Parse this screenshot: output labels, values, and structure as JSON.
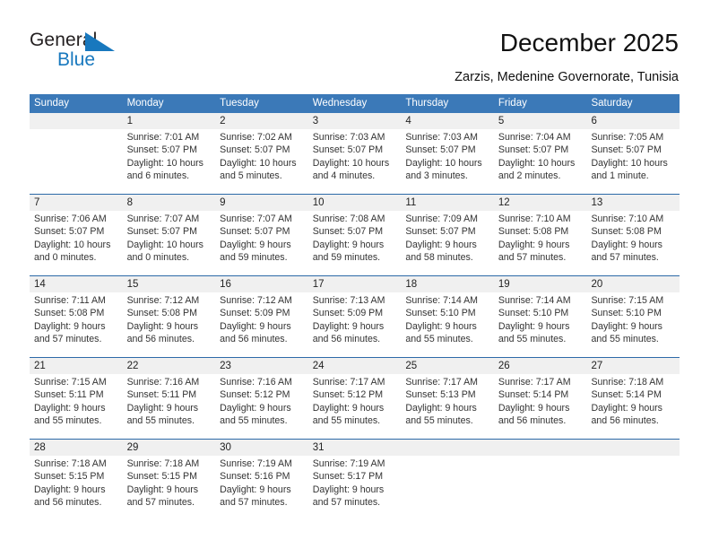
{
  "brand": {
    "name_top": "General",
    "name_bottom": "Blue",
    "mark": "triangle-logo-mark",
    "accent_color": "#1878be"
  },
  "header": {
    "title": "December 2025",
    "subtitle": "Zarzis, Medenine Governorate, Tunisia"
  },
  "calendar": {
    "header_bg": "#3b79b8",
    "daynum_bg": "#f0f0f0",
    "weekdays": [
      "Sunday",
      "Monday",
      "Tuesday",
      "Wednesday",
      "Thursday",
      "Friday",
      "Saturday"
    ],
    "weeks": [
      [
        {
          "day": ""
        },
        {
          "day": "1",
          "sunrise": "Sunrise: 7:01 AM",
          "sunset": "Sunset: 5:07 PM",
          "daylight1": "Daylight: 10 hours",
          "daylight2": "and 6 minutes."
        },
        {
          "day": "2",
          "sunrise": "Sunrise: 7:02 AM",
          "sunset": "Sunset: 5:07 PM",
          "daylight1": "Daylight: 10 hours",
          "daylight2": "and 5 minutes."
        },
        {
          "day": "3",
          "sunrise": "Sunrise: 7:03 AM",
          "sunset": "Sunset: 5:07 PM",
          "daylight1": "Daylight: 10 hours",
          "daylight2": "and 4 minutes."
        },
        {
          "day": "4",
          "sunrise": "Sunrise: 7:03 AM",
          "sunset": "Sunset: 5:07 PM",
          "daylight1": "Daylight: 10 hours",
          "daylight2": "and 3 minutes."
        },
        {
          "day": "5",
          "sunrise": "Sunrise: 7:04 AM",
          "sunset": "Sunset: 5:07 PM",
          "daylight1": "Daylight: 10 hours",
          "daylight2": "and 2 minutes."
        },
        {
          "day": "6",
          "sunrise": "Sunrise: 7:05 AM",
          "sunset": "Sunset: 5:07 PM",
          "daylight1": "Daylight: 10 hours",
          "daylight2": "and 1 minute."
        }
      ],
      [
        {
          "day": "7",
          "sunrise": "Sunrise: 7:06 AM",
          "sunset": "Sunset: 5:07 PM",
          "daylight1": "Daylight: 10 hours",
          "daylight2": "and 0 minutes."
        },
        {
          "day": "8",
          "sunrise": "Sunrise: 7:07 AM",
          "sunset": "Sunset: 5:07 PM",
          "daylight1": "Daylight: 10 hours",
          "daylight2": "and 0 minutes."
        },
        {
          "day": "9",
          "sunrise": "Sunrise: 7:07 AM",
          "sunset": "Sunset: 5:07 PM",
          "daylight1": "Daylight: 9 hours",
          "daylight2": "and 59 minutes."
        },
        {
          "day": "10",
          "sunrise": "Sunrise: 7:08 AM",
          "sunset": "Sunset: 5:07 PM",
          "daylight1": "Daylight: 9 hours",
          "daylight2": "and 59 minutes."
        },
        {
          "day": "11",
          "sunrise": "Sunrise: 7:09 AM",
          "sunset": "Sunset: 5:07 PM",
          "daylight1": "Daylight: 9 hours",
          "daylight2": "and 58 minutes."
        },
        {
          "day": "12",
          "sunrise": "Sunrise: 7:10 AM",
          "sunset": "Sunset: 5:08 PM",
          "daylight1": "Daylight: 9 hours",
          "daylight2": "and 57 minutes."
        },
        {
          "day": "13",
          "sunrise": "Sunrise: 7:10 AM",
          "sunset": "Sunset: 5:08 PM",
          "daylight1": "Daylight: 9 hours",
          "daylight2": "and 57 minutes."
        }
      ],
      [
        {
          "day": "14",
          "sunrise": "Sunrise: 7:11 AM",
          "sunset": "Sunset: 5:08 PM",
          "daylight1": "Daylight: 9 hours",
          "daylight2": "and 57 minutes."
        },
        {
          "day": "15",
          "sunrise": "Sunrise: 7:12 AM",
          "sunset": "Sunset: 5:08 PM",
          "daylight1": "Daylight: 9 hours",
          "daylight2": "and 56 minutes."
        },
        {
          "day": "16",
          "sunrise": "Sunrise: 7:12 AM",
          "sunset": "Sunset: 5:09 PM",
          "daylight1": "Daylight: 9 hours",
          "daylight2": "and 56 minutes."
        },
        {
          "day": "17",
          "sunrise": "Sunrise: 7:13 AM",
          "sunset": "Sunset: 5:09 PM",
          "daylight1": "Daylight: 9 hours",
          "daylight2": "and 56 minutes."
        },
        {
          "day": "18",
          "sunrise": "Sunrise: 7:14 AM",
          "sunset": "Sunset: 5:10 PM",
          "daylight1": "Daylight: 9 hours",
          "daylight2": "and 55 minutes."
        },
        {
          "day": "19",
          "sunrise": "Sunrise: 7:14 AM",
          "sunset": "Sunset: 5:10 PM",
          "daylight1": "Daylight: 9 hours",
          "daylight2": "and 55 minutes."
        },
        {
          "day": "20",
          "sunrise": "Sunrise: 7:15 AM",
          "sunset": "Sunset: 5:10 PM",
          "daylight1": "Daylight: 9 hours",
          "daylight2": "and 55 minutes."
        }
      ],
      [
        {
          "day": "21",
          "sunrise": "Sunrise: 7:15 AM",
          "sunset": "Sunset: 5:11 PM",
          "daylight1": "Daylight: 9 hours",
          "daylight2": "and 55 minutes."
        },
        {
          "day": "22",
          "sunrise": "Sunrise: 7:16 AM",
          "sunset": "Sunset: 5:11 PM",
          "daylight1": "Daylight: 9 hours",
          "daylight2": "and 55 minutes."
        },
        {
          "day": "23",
          "sunrise": "Sunrise: 7:16 AM",
          "sunset": "Sunset: 5:12 PM",
          "daylight1": "Daylight: 9 hours",
          "daylight2": "and 55 minutes."
        },
        {
          "day": "24",
          "sunrise": "Sunrise: 7:17 AM",
          "sunset": "Sunset: 5:12 PM",
          "daylight1": "Daylight: 9 hours",
          "daylight2": "and 55 minutes."
        },
        {
          "day": "25",
          "sunrise": "Sunrise: 7:17 AM",
          "sunset": "Sunset: 5:13 PM",
          "daylight1": "Daylight: 9 hours",
          "daylight2": "and 55 minutes."
        },
        {
          "day": "26",
          "sunrise": "Sunrise: 7:17 AM",
          "sunset": "Sunset: 5:14 PM",
          "daylight1": "Daylight: 9 hours",
          "daylight2": "and 56 minutes."
        },
        {
          "day": "27",
          "sunrise": "Sunrise: 7:18 AM",
          "sunset": "Sunset: 5:14 PM",
          "daylight1": "Daylight: 9 hours",
          "daylight2": "and 56 minutes."
        }
      ],
      [
        {
          "day": "28",
          "sunrise": "Sunrise: 7:18 AM",
          "sunset": "Sunset: 5:15 PM",
          "daylight1": "Daylight: 9 hours",
          "daylight2": "and 56 minutes."
        },
        {
          "day": "29",
          "sunrise": "Sunrise: 7:18 AM",
          "sunset": "Sunset: 5:15 PM",
          "daylight1": "Daylight: 9 hours",
          "daylight2": "and 57 minutes."
        },
        {
          "day": "30",
          "sunrise": "Sunrise: 7:19 AM",
          "sunset": "Sunset: 5:16 PM",
          "daylight1": "Daylight: 9 hours",
          "daylight2": "and 57 minutes."
        },
        {
          "day": "31",
          "sunrise": "Sunrise: 7:19 AM",
          "sunset": "Sunset: 5:17 PM",
          "daylight1": "Daylight: 9 hours",
          "daylight2": "and 57 minutes."
        },
        {
          "day": ""
        },
        {
          "day": ""
        },
        {
          "day": ""
        }
      ]
    ]
  }
}
